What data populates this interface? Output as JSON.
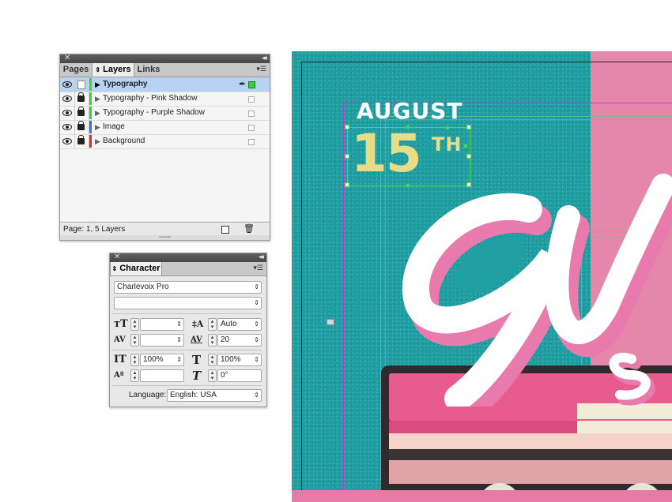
{
  "layers_panel": {
    "tabs": [
      "Pages",
      "Layers",
      "Links"
    ],
    "active_tab": "Layers",
    "layers": [
      {
        "name": "Typography",
        "visible": true,
        "locked": false,
        "color": "#33d633",
        "selected": true
      },
      {
        "name": "Typography - Pink Shadow",
        "visible": true,
        "locked": true,
        "color": "#33d633",
        "selected": false
      },
      {
        "name": "Typography - Purple Shadow",
        "visible": true,
        "locked": true,
        "color": "#33d633",
        "selected": false
      },
      {
        "name": "Image",
        "visible": true,
        "locked": true,
        "color": "#3e6de0",
        "selected": false
      },
      {
        "name": "Background",
        "visible": true,
        "locked": true,
        "color": "#e02a2a",
        "selected": false
      }
    ],
    "status": "Page: 1, 5 Layers"
  },
  "character_panel": {
    "title": "Character",
    "font_family": "Charlevoix Pro",
    "font_style": "",
    "font_size": "",
    "leading": "Auto",
    "kerning": "",
    "tracking": "20",
    "vertical_scale": "100%",
    "horizontal_scale": "100%",
    "baseline_shift": "",
    "skew": "0°",
    "language_label": "Language:",
    "language": "English: USA"
  },
  "artboard": {
    "month": "AUGUST",
    "day": "15",
    "day_suffix": "TH",
    "colors": {
      "teal": "#21a0a4",
      "pink": "#e487a9",
      "yellow": "#e6dd86",
      "white": "#ffffff"
    }
  }
}
